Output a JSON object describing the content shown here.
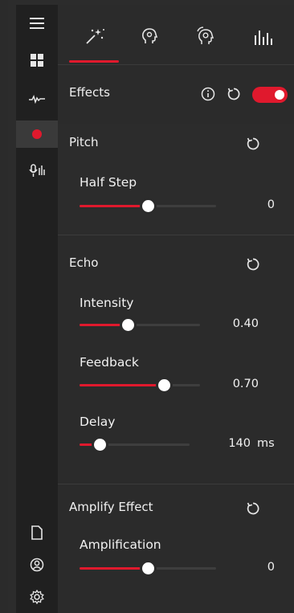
{
  "tabs": [
    {
      "icon": "magic-wand-icon",
      "selected": true
    },
    {
      "icon": "voice-head-icon",
      "selected": false
    },
    {
      "icon": "voice-loop-icon",
      "selected": false
    },
    {
      "icon": "equalizer-icon",
      "selected": false
    }
  ],
  "rail": {
    "items": [
      {
        "icon": "menu-icon"
      },
      {
        "icon": "grid-icon"
      },
      {
        "icon": "waveform-icon"
      },
      {
        "icon": "record-icon",
        "active": true
      },
      {
        "icon": "microphone-settings-icon"
      },
      {
        "icon": "file-icon"
      },
      {
        "icon": "account-icon"
      },
      {
        "icon": "settings-icon"
      }
    ]
  },
  "effects": {
    "title": "Effects",
    "enabled": true
  },
  "pitch": {
    "title": "Pitch",
    "half_step": {
      "label": "Half Step",
      "value": "0",
      "fraction": 0.5
    }
  },
  "echo": {
    "title": "Echo",
    "intensity": {
      "label": "Intensity",
      "value": "0.40",
      "fraction": 0.4
    },
    "feedback": {
      "label": "Feedback",
      "value": "0.70",
      "fraction": 0.7
    },
    "delay": {
      "label": "Delay",
      "value": "140",
      "unit": "ms",
      "fraction": 0.18
    }
  },
  "amplify": {
    "title": "Amplify Effect",
    "amplification": {
      "label": "Amplification",
      "value": "0",
      "fraction": 0.5
    }
  },
  "colors": {
    "accent": "#e0192d",
    "background": "#2b2b2b",
    "rail": "#202020"
  }
}
